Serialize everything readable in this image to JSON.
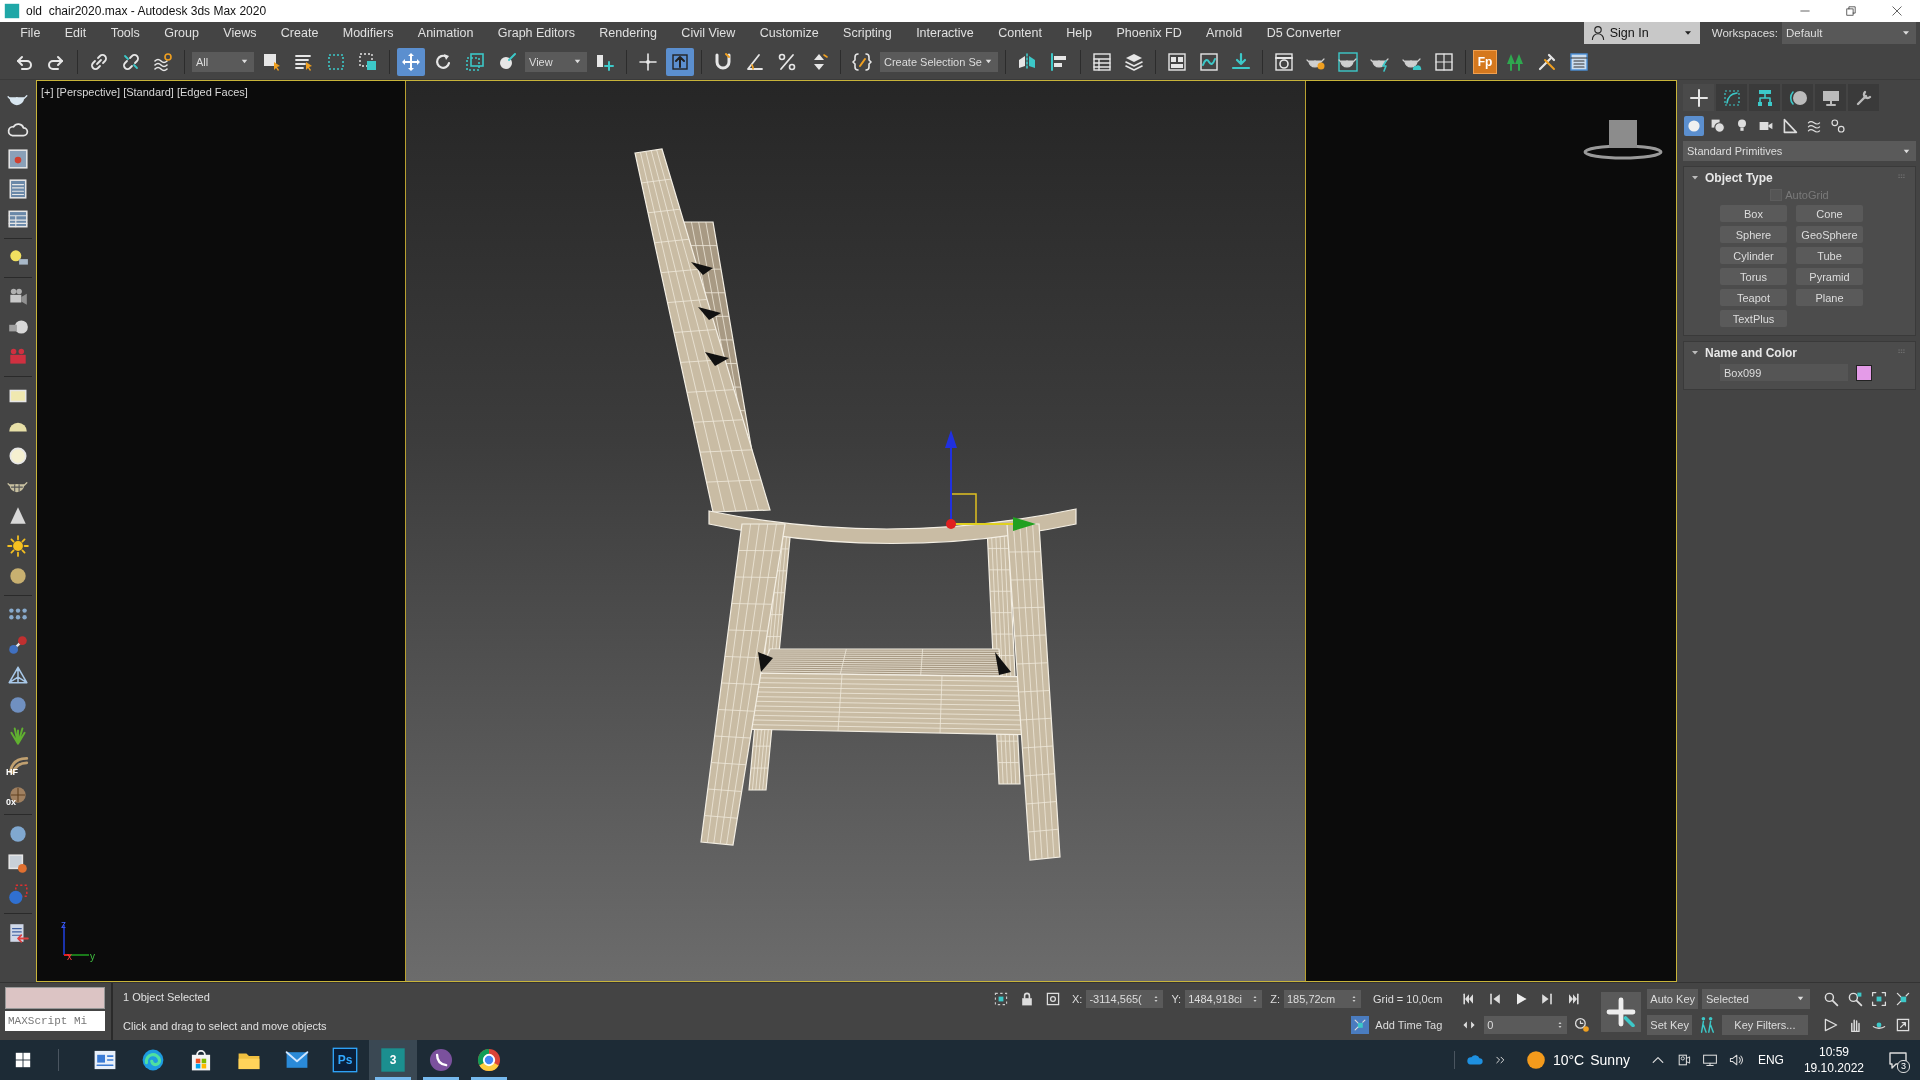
{
  "window": {
    "title": "old  chair2020.max - Autodesk 3ds Max 2020"
  },
  "menu": [
    "File",
    "Edit",
    "Tools",
    "Group",
    "Views",
    "Create",
    "Modifiers",
    "Animation",
    "Graph Editors",
    "Rendering",
    "Civil View",
    "Customize",
    "Scripting",
    "Interactive",
    "Content",
    "Help",
    "Phoenix FD",
    "Arnold",
    "D5 Converter"
  ],
  "account": {
    "sign_in": "Sign In",
    "workspaces_label": "Workspaces:",
    "workspace": "Default"
  },
  "toolbar": [
    {
      "kind": "button",
      "selected": false
    },
    {
      "kind": "button",
      "selected": false
    },
    {
      "kind": "separator"
    },
    {
      "kind": "button",
      "selected": false
    },
    {
      "kind": "button",
      "selected": false
    },
    {
      "kind": "button",
      "selected": false
    },
    {
      "kind": "separator"
    },
    {
      "kind": "dropdown",
      "value": "All"
    },
    {
      "kind": "button",
      "selected": false
    },
    {
      "kind": "button",
      "selected": false
    },
    {
      "kind": "button",
      "selected": false
    },
    {
      "kind": "button",
      "selected": false
    },
    {
      "kind": "separator"
    },
    {
      "kind": "button",
      "selected": true
    },
    {
      "kind": "button",
      "selected": false
    },
    {
      "kind": "button",
      "selected": false
    },
    {
      "kind": "button",
      "selected": false
    },
    {
      "kind": "dropdown",
      "value": "View"
    },
    {
      "kind": "button",
      "selected": false
    },
    {
      "kind": "separator"
    },
    {
      "kind": "button",
      "selected": false
    },
    {
      "kind": "button",
      "selected": true
    },
    {
      "kind": "separator"
    },
    {
      "kind": "button",
      "selected": false
    },
    {
      "kind": "button",
      "selected": false
    },
    {
      "kind": "button",
      "selected": false
    },
    {
      "kind": "button",
      "selected": false
    },
    {
      "kind": "separator"
    },
    {
      "kind": "button",
      "selected": false
    },
    {
      "kind": "dropdown",
      "value": "Create Selection Se"
    },
    {
      "kind": "separator"
    },
    {
      "kind": "button",
      "selected": false
    },
    {
      "kind": "button",
      "selected": false
    },
    {
      "kind": "separator"
    },
    {
      "kind": "button",
      "selected": false
    },
    {
      "kind": "button",
      "selected": false
    },
    {
      "kind": "separator"
    },
    {
      "kind": "button",
      "selected": false
    },
    {
      "kind": "button",
      "selected": false
    },
    {
      "kind": "button",
      "selected": false
    },
    {
      "kind": "separator"
    },
    {
      "kind": "button",
      "selected": false
    },
    {
      "kind": "button",
      "selected": false
    },
    {
      "kind": "button",
      "selected": false
    },
    {
      "kind": "button",
      "selected": false
    },
    {
      "kind": "button",
      "selected": false
    },
    {
      "kind": "button",
      "selected": false
    },
    {
      "kind": "separator"
    },
    {
      "kind": "text-button",
      "label": "Fp"
    },
    {
      "kind": "button",
      "selected": false
    },
    {
      "kind": "button",
      "selected": false
    },
    {
      "kind": "button",
      "selected": false
    }
  ],
  "left_toolbar": [
    {
      "kind": "button"
    },
    {
      "kind": "button"
    },
    {
      "kind": "button"
    },
    {
      "kind": "button"
    },
    {
      "kind": "button"
    },
    {
      "kind": "separator"
    },
    {
      "kind": "button"
    },
    {
      "kind": "separator"
    },
    {
      "kind": "button"
    },
    {
      "kind": "button"
    },
    {
      "kind": "button"
    },
    {
      "kind": "separator"
    },
    {
      "kind": "button"
    },
    {
      "kind": "button"
    },
    {
      "kind": "button"
    },
    {
      "kind": "button"
    },
    {
      "kind": "button"
    },
    {
      "kind": "button"
    },
    {
      "kind": "button"
    },
    {
      "kind": "separator"
    },
    {
      "kind": "button"
    },
    {
      "kind": "button"
    },
    {
      "kind": "button"
    },
    {
      "kind": "button"
    },
    {
      "kind": "button"
    },
    {
      "kind": "button",
      "label": "HF"
    },
    {
      "kind": "button",
      "label": "0x"
    },
    {
      "kind": "separator"
    },
    {
      "kind": "button"
    },
    {
      "kind": "button"
    },
    {
      "kind": "button"
    },
    {
      "kind": "separator"
    },
    {
      "kind": "button"
    }
  ],
  "viewport": {
    "labels": [
      "[+]",
      "[Perspective]",
      "[Standard]",
      "[Edged Faces]"
    ],
    "axis_labels": [
      "z",
      "x",
      "y"
    ]
  },
  "command_panel": {
    "tabs": [
      {
        "selected": true
      },
      {
        "selected": false
      },
      {
        "selected": false
      },
      {
        "selected": false
      },
      {
        "selected": false
      },
      {
        "selected": false
      }
    ],
    "categories": [
      {
        "selected": true
      },
      {
        "selected": false
      },
      {
        "selected": false
      },
      {
        "selected": false
      },
      {
        "selected": false
      },
      {
        "selected": false
      },
      {
        "selected": false
      }
    ],
    "category_dropdown": "Standard Primitives",
    "object_type": {
      "title": "Object Type",
      "expanded": true,
      "autogrid": {
        "label": "AutoGrid",
        "checked": false,
        "disabled": true
      },
      "buttons": [
        "Box",
        "Cone",
        "Sphere",
        "GeoSphere",
        "Cylinder",
        "Tube",
        "Torus",
        "Pyramid",
        "Teapot",
        "Plane",
        "TextPlus"
      ]
    },
    "name_and_color": {
      "title": "Name and Color",
      "expanded": true,
      "name": "Box099",
      "color": "#e49be8"
    }
  },
  "status_bar": {
    "listener": "MAXScript Mi",
    "selection": "1 Object Selected",
    "prompt": "Click and drag to select and move objects",
    "coordinates": [
      {
        "axis": "X:",
        "value": "-3114,565("
      },
      {
        "axis": "Y:",
        "value": "1484,918ci"
      },
      {
        "axis": "Z:",
        "value": "185,72cm"
      }
    ],
    "grid": "Grid = 10,0cm",
    "time_tag": "Add Time Tag"
  },
  "animation_controls": {
    "frame": "0",
    "auto_key": {
      "label": "Auto Key",
      "on": false
    },
    "key_mode": "Selected",
    "set_key": "Set Key",
    "key_filters": "Key Filters..."
  },
  "taskbar": {
    "apps": [
      {
        "running": false,
        "selected": false
      },
      {
        "running": false,
        "selected": false
      },
      {
        "running": false,
        "selected": false
      },
      {
        "running": false,
        "selected": false
      },
      {
        "running": false,
        "selected": false
      },
      {
        "label": "Ps",
        "running": false,
        "selected": false
      },
      {
        "label": "3",
        "running": true,
        "selected": true
      },
      {
        "running": true,
        "selected": false
      },
      {
        "running": true,
        "selected": false
      }
    ],
    "tray": {
      "temperature": "10°C",
      "condition": "Sunny",
      "language": "ENG",
      "time": "10:59",
      "date": "19.10.2022",
      "notifications": "3"
    }
  }
}
